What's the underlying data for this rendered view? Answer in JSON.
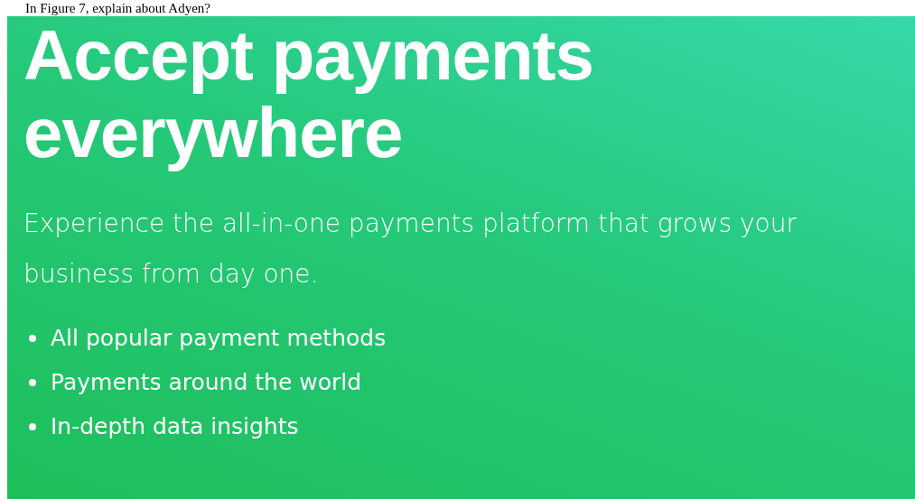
{
  "question": "In Figure 7, explain about Adyen?",
  "hero": {
    "heading": "Accept payments everywhere",
    "subtitle": "Experience the all-in-one payments platform that grows your business from day one.",
    "features": [
      "All popular payment methods",
      "Payments around the world",
      "In-depth data insights"
    ]
  }
}
